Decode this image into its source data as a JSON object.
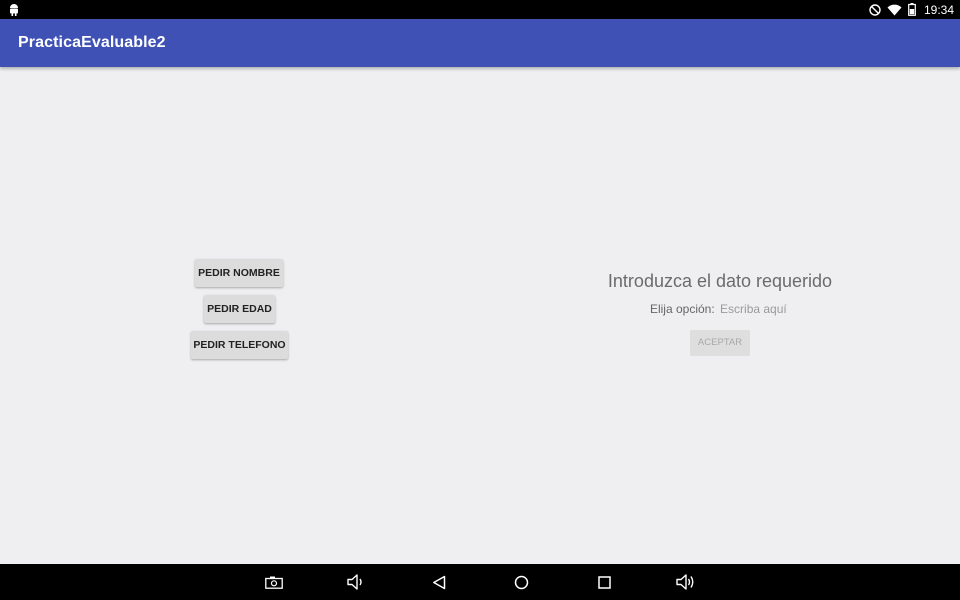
{
  "status_bar": {
    "time": "19:34",
    "icons": [
      "android-icon",
      "do-not-disturb-icon",
      "wifi-icon",
      "battery-icon"
    ]
  },
  "app_bar": {
    "title": "PracticaEvaluable2",
    "color": "#3f51b5"
  },
  "left_panel": {
    "buttons": [
      {
        "label": "PEDIR NOMBRE"
      },
      {
        "label": "PEDIR EDAD"
      },
      {
        "label": "PEDIR TELEFONO"
      }
    ]
  },
  "right_panel": {
    "title": "Introduzca el dato requerido",
    "option_label": "Elija opción:",
    "input_placeholder": "Escriba aquí",
    "input_value": "",
    "accept_label": "ACEPTAR",
    "accept_enabled": false
  },
  "nav_bar": {
    "icons": [
      "screenshot-icon",
      "volume-down-icon",
      "back-icon",
      "home-icon",
      "recents-icon",
      "volume-up-icon"
    ]
  }
}
